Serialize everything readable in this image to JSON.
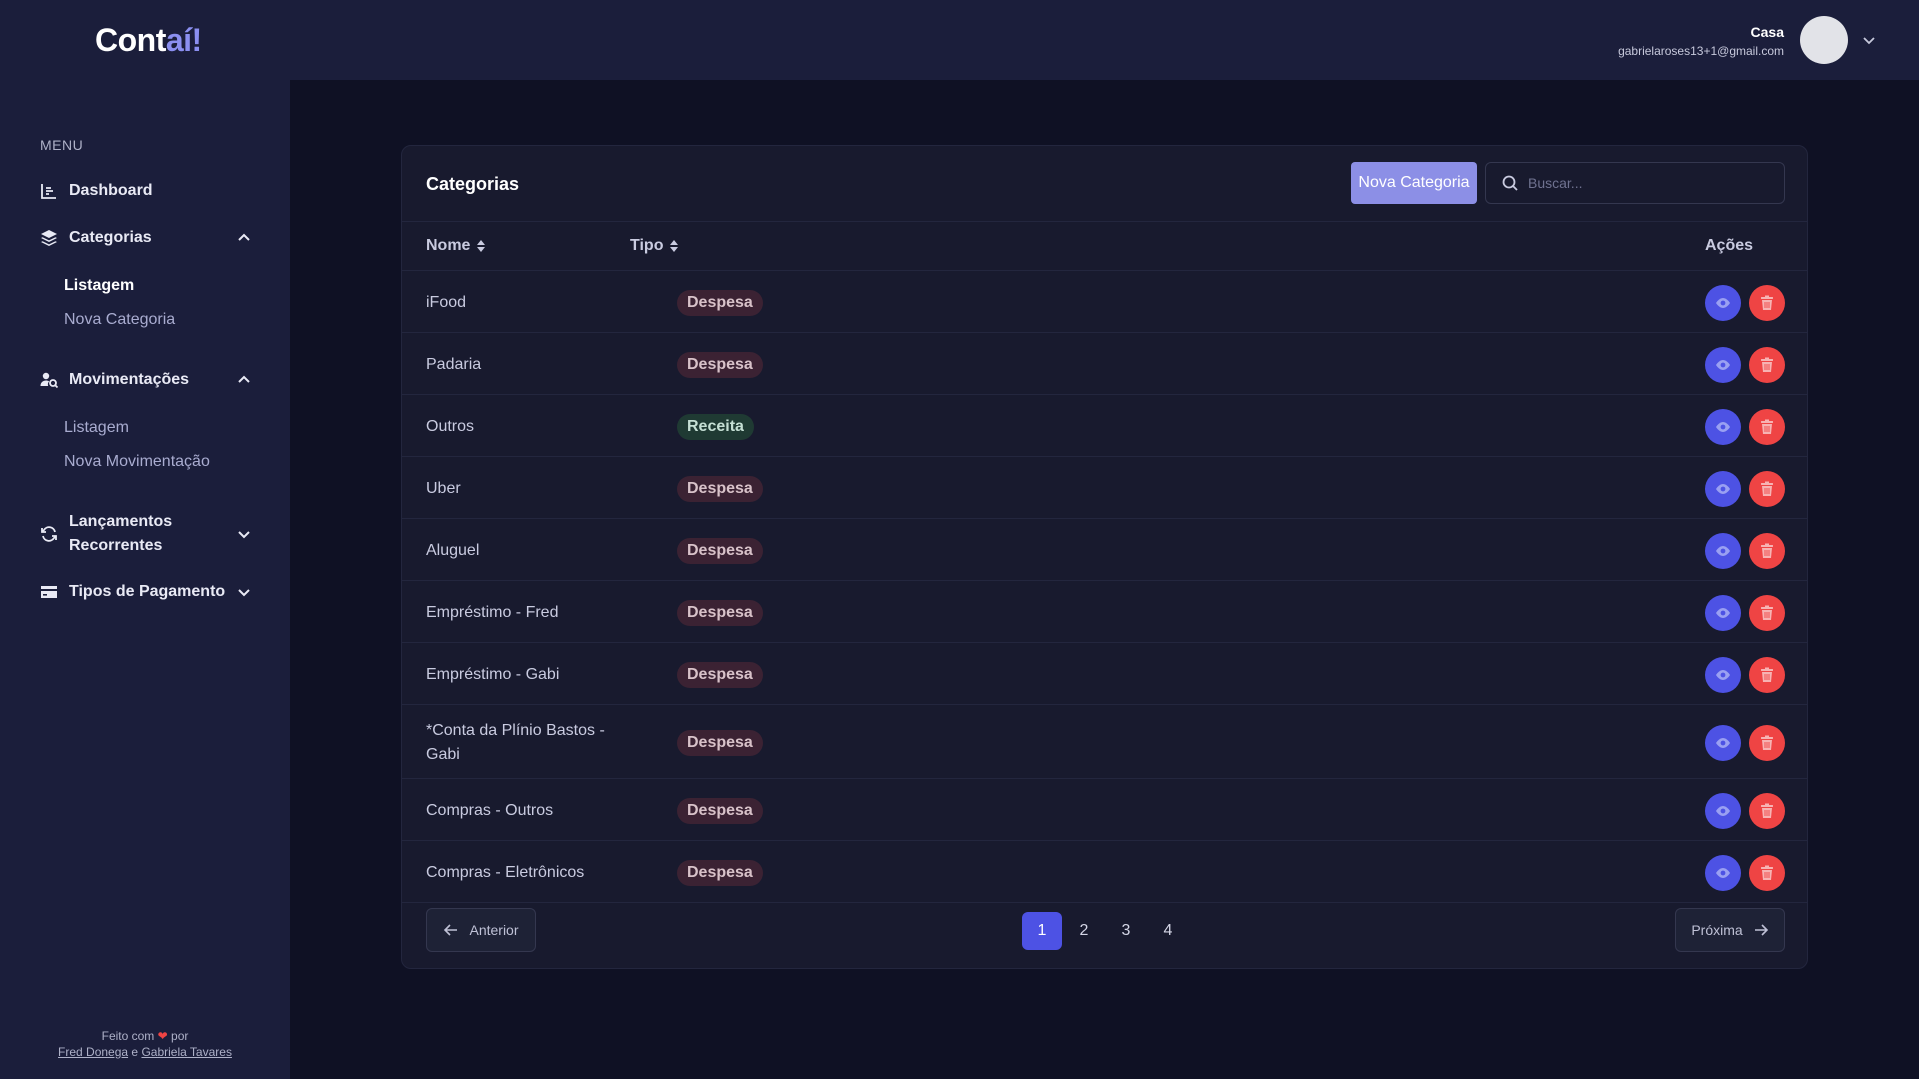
{
  "app": {
    "logo_main": "Cont",
    "logo_accent": "aí!"
  },
  "user": {
    "name": "Casa",
    "email": "gabrielaroses13+1@gmail.com"
  },
  "sidebar": {
    "menu_heading": "MENU",
    "dashboard": "Dashboard",
    "categorias": "Categorias",
    "categorias_sub": [
      "Listagem",
      "Nova Categoria"
    ],
    "movimentacoes": "Movimentações",
    "movimentacoes_sub": [
      "Listagem",
      "Nova Movimentação"
    ],
    "lancamentos_line1": "Lançamentos",
    "lancamentos_line2": "Recorrentes",
    "tipos_pagamento": "Tipos de Pagamento"
  },
  "footer": {
    "made_with": "Feito com",
    "by": "por",
    "author1": "Fred Donega",
    "and": "e",
    "author2": "Gabriela Tavares"
  },
  "card": {
    "title": "Categorias",
    "new_button": "Nova Categoria",
    "search_placeholder": "Buscar...",
    "columns": {
      "nome": "Nome",
      "tipo": "Tipo",
      "acoes": "Ações"
    }
  },
  "rows": [
    {
      "name": "iFood",
      "type": "Despesa"
    },
    {
      "name": "Padaria",
      "type": "Despesa"
    },
    {
      "name": "Outros",
      "type": "Receita"
    },
    {
      "name": "Uber",
      "type": "Despesa"
    },
    {
      "name": "Aluguel",
      "type": "Despesa"
    },
    {
      "name": "Empréstimo - Fred",
      "type": "Despesa"
    },
    {
      "name": "Empréstimo - Gabi",
      "type": "Despesa"
    },
    {
      "name": "*Conta da Plínio Bastos - Gabi",
      "type": "Despesa"
    },
    {
      "name": "Compras - Outros",
      "type": "Despesa"
    },
    {
      "name": "Compras - Eletrônicos",
      "type": "Despesa"
    }
  ],
  "pagination": {
    "prev": "Anterior",
    "next": "Próxima",
    "pages": [
      "1",
      "2",
      "3",
      "4"
    ],
    "current": "1"
  },
  "colors": {
    "sidebar_bg": "#1b1e3b",
    "page_bg": "#0f1124",
    "accent": "#8c8fe6",
    "primary": "#4d52e4",
    "danger": "#ef4444"
  }
}
